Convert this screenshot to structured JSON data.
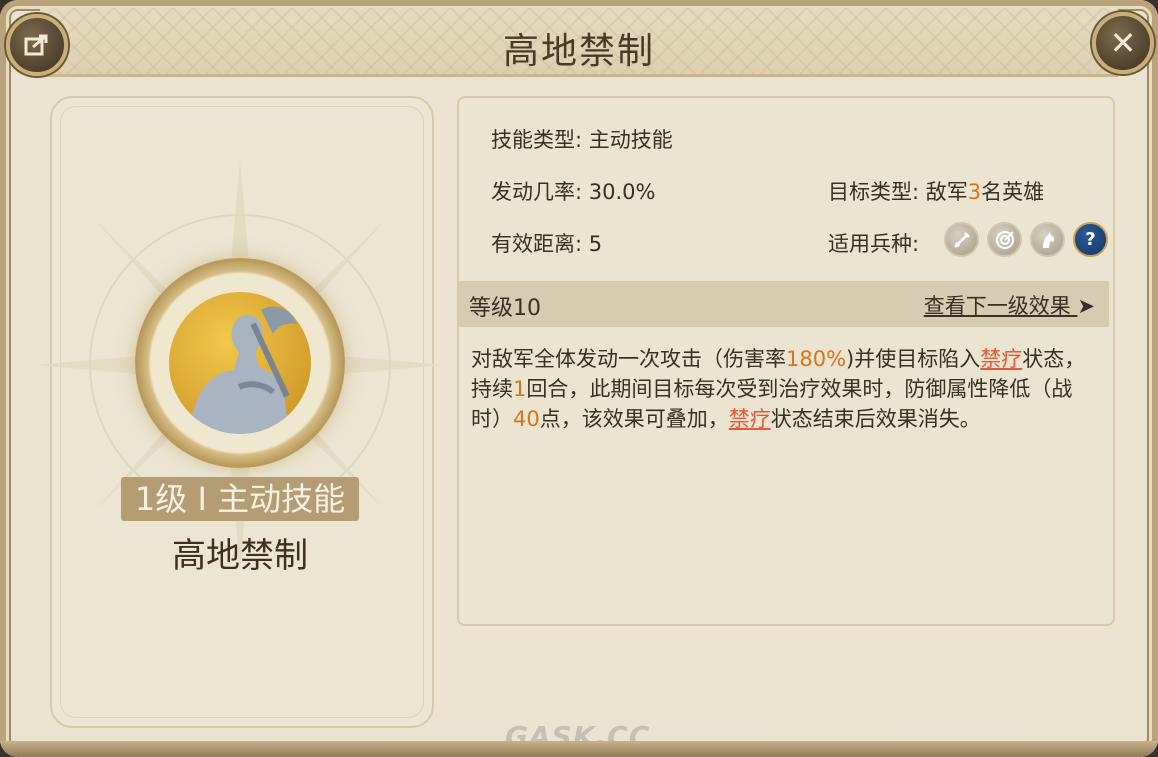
{
  "window": {
    "title": "高地禁制"
  },
  "skill_card": {
    "level_type": "1级 I 主动技能",
    "name": "高地禁制",
    "icon": "warrior-axe-portrait"
  },
  "info": {
    "skill_type": "技能类型: 主动技能",
    "trigger_rate": "发动几率: 30.0%",
    "target_type_prefix": "目标类型: 敌军",
    "target_count": "3",
    "target_type_suffix": "名英雄",
    "range": "有效距离: 5",
    "unit_types_label": "适用兵种:",
    "unit_icons": [
      "sword-icon",
      "target-icon",
      "horse-icon",
      "question-icon"
    ]
  },
  "level_bar": {
    "level": "等级10",
    "next_level": "查看下一级效果"
  },
  "description": {
    "p1": "对敌军全体发动一次攻击（伤害率",
    "dmg": "180%",
    "p2": ")并使目标陷入",
    "status": "禁疗",
    "p3": "状态，持续",
    "turns": "1",
    "p4": "回合，此期间目标每次受到治疗效果时，防御属性降低（战时）",
    "value": "40",
    "p5": "点，该效果可叠加，",
    "status2": "禁疗",
    "p6": "状态结束后效果消失。"
  },
  "watermark": {
    "a": "GASK",
    "dot": ".",
    "b": "CC"
  },
  "colors": {
    "accent": "#d9731d",
    "status": "#e25a3a"
  }
}
